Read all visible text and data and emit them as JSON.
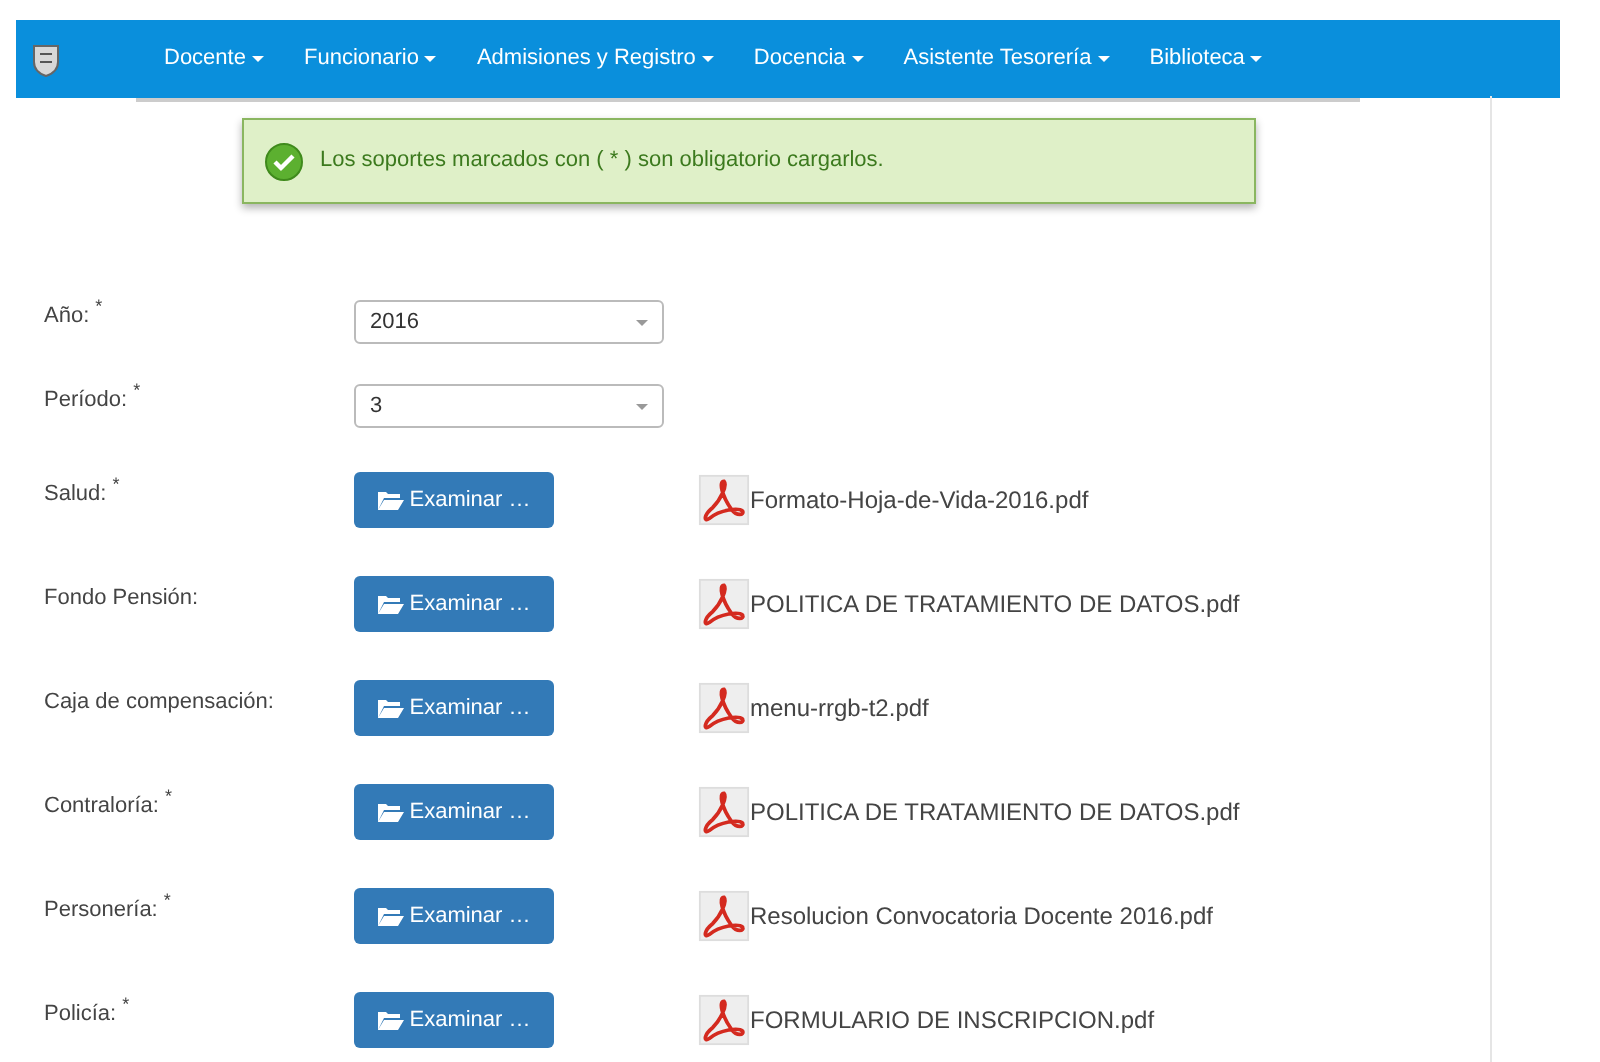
{
  "navbar": {
    "items": [
      {
        "label": "Docente"
      },
      {
        "label": "Funcionario"
      },
      {
        "label": "Admisiones y Registro"
      },
      {
        "label": "Docencia"
      },
      {
        "label": "Asistente Tesorería"
      },
      {
        "label": "Biblioteca"
      }
    ]
  },
  "alert": {
    "text": "Los soportes marcados con ( * ) son obligatorio cargarlos."
  },
  "fields": [
    {
      "kind": "select",
      "label": "Año:",
      "mark": "*",
      "value": "2016"
    },
    {
      "kind": "select",
      "label": "Período:",
      "mark": "*",
      "value": "3"
    },
    {
      "kind": "file",
      "label": "Salud:",
      "mark": "*",
      "button": "Examinar …",
      "file": "Formato-Hoja-de-Vida-2016.pdf"
    },
    {
      "kind": "file",
      "label": "Fondo Pensión:",
      "button": "Examinar …",
      "file": "POLITICA DE TRATAMIENTO DE DATOS.pdf"
    },
    {
      "kind": "file",
      "label": "Caja de compensación:",
      "button": "Examinar …",
      "file": "menu-rrgb-t2.pdf"
    },
    {
      "kind": "file",
      "label": "Contraloría:",
      "mark": "*",
      "button": "Examinar …",
      "file": "POLITICA DE TRATAMIENTO DE DATOS.pdf"
    },
    {
      "kind": "file",
      "label": "Personería:",
      "mark": "*",
      "button": "Examinar …",
      "file": "Resolucion Convocatoria Docente 2016.pdf"
    },
    {
      "kind": "file",
      "label": "Policía:",
      "mark": "*",
      "button": "Examinar …",
      "file": "FORMULARIO DE INSCRIPCION.pdf"
    }
  ]
}
